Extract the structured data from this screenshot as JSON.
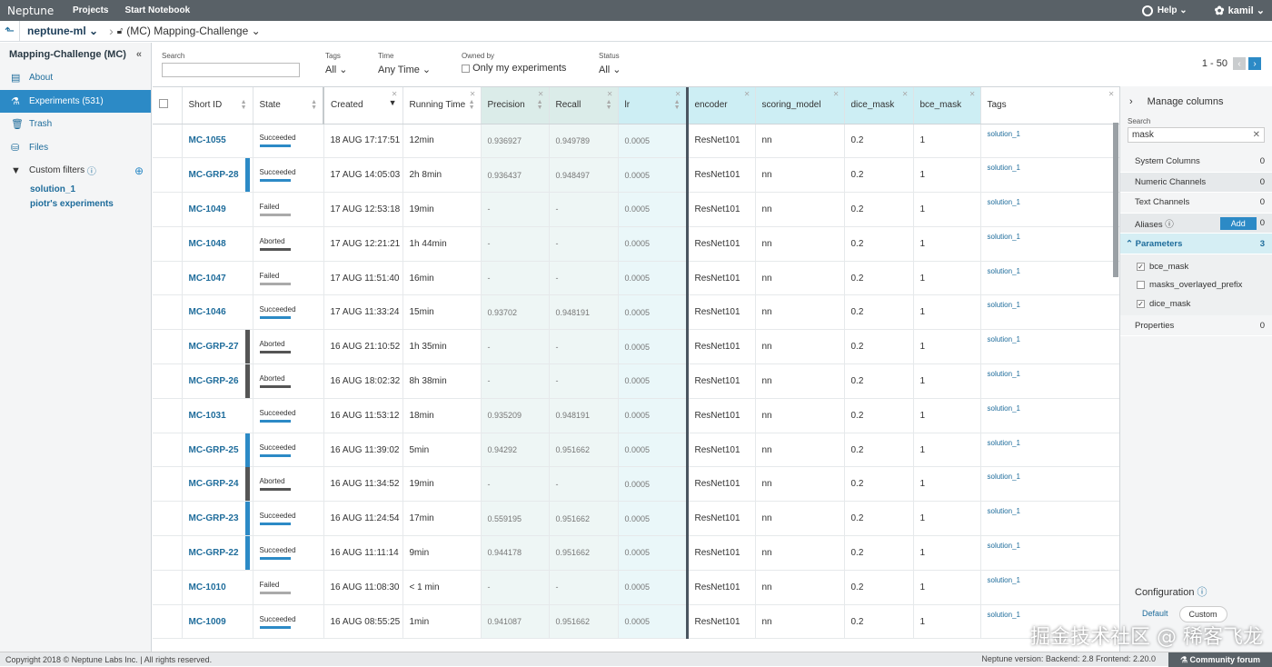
{
  "topbar": {
    "logo": "Neptune",
    "nav": [
      "Projects",
      "Start Notebook"
    ],
    "help": "Help",
    "user": "kamil"
  },
  "breadcrumb": {
    "org": "neptune-ml",
    "project": "(MC) Mapping-Challenge"
  },
  "sidebar": {
    "title": "Mapping-Challenge (MC)",
    "items": [
      {
        "label": "About"
      },
      {
        "label": "Experiments (531)"
      },
      {
        "label": "Trash"
      },
      {
        "label": "Files"
      }
    ],
    "filters_label": "Custom filters",
    "filters": [
      "solution_1",
      "piotr's experiments"
    ]
  },
  "filters": {
    "search_label": "Search",
    "tags_label": "Tags",
    "tags_value": "All",
    "time_label": "Time",
    "time_value": "Any Time",
    "owned_label": "Owned by",
    "owned_value": "Only my experiments",
    "status_label": "Status",
    "status_value": "All",
    "pager": "1 - 50"
  },
  "columns": [
    "Short ID",
    "State",
    "Created",
    "Running Time",
    "Precision",
    "Recall",
    "lr",
    "encoder",
    "scoring_model",
    "dice_mask",
    "bce_mask",
    "Tags"
  ],
  "rows": [
    {
      "id": "MC-1055",
      "state": "Succeeded",
      "created": "18 AUG 17:17:51",
      "running": "12min",
      "precision": "0.936927",
      "recall": "0.949789",
      "lr": "0.0005",
      "encoder": "ResNet101",
      "scoring": "nn",
      "dice": "0.2",
      "bce": "1",
      "tag": "solution_1",
      "group": false
    },
    {
      "id": "MC-GRP-28",
      "state": "Succeeded",
      "created": "17 AUG 14:05:03",
      "running": "2h 8min",
      "precision": "0.936437",
      "recall": "0.948497",
      "lr": "0.0005",
      "encoder": "ResNet101",
      "scoring": "nn",
      "dice": "0.2",
      "bce": "1",
      "tag": "solution_1",
      "group": true
    },
    {
      "id": "MC-1049",
      "state": "Failed",
      "created": "17 AUG 12:53:18",
      "running": "19min",
      "precision": "-",
      "recall": "-",
      "lr": "0.0005",
      "encoder": "ResNet101",
      "scoring": "nn",
      "dice": "0.2",
      "bce": "1",
      "tag": "solution_1",
      "group": false
    },
    {
      "id": "MC-1048",
      "state": "Aborted",
      "created": "17 AUG 12:21:21",
      "running": "1h 44min",
      "precision": "-",
      "recall": "-",
      "lr": "0.0005",
      "encoder": "ResNet101",
      "scoring": "nn",
      "dice": "0.2",
      "bce": "1",
      "tag": "solution_1",
      "group": false
    },
    {
      "id": "MC-1047",
      "state": "Failed",
      "created": "17 AUG 11:51:40",
      "running": "16min",
      "precision": "-",
      "recall": "-",
      "lr": "0.0005",
      "encoder": "ResNet101",
      "scoring": "nn",
      "dice": "0.2",
      "bce": "1",
      "tag": "solution_1",
      "group": false
    },
    {
      "id": "MC-1046",
      "state": "Succeeded",
      "created": "17 AUG 11:33:24",
      "running": "15min",
      "precision": "0.93702",
      "recall": "0.948191",
      "lr": "0.0005",
      "encoder": "ResNet101",
      "scoring": "nn",
      "dice": "0.2",
      "bce": "1",
      "tag": "solution_1",
      "group": false
    },
    {
      "id": "MC-GRP-27",
      "state": "Aborted",
      "created": "16 AUG 21:10:52",
      "running": "1h 35min",
      "precision": "-",
      "recall": "-",
      "lr": "0.0005",
      "encoder": "ResNet101",
      "scoring": "nn",
      "dice": "0.2",
      "bce": "1",
      "tag": "solution_1",
      "group": true
    },
    {
      "id": "MC-GRP-26",
      "state": "Aborted",
      "created": "16 AUG 18:02:32",
      "running": "8h 38min",
      "precision": "-",
      "recall": "-",
      "lr": "0.0005",
      "encoder": "ResNet101",
      "scoring": "nn",
      "dice": "0.2",
      "bce": "1",
      "tag": "solution_1",
      "group": true
    },
    {
      "id": "MC-1031",
      "state": "Succeeded",
      "created": "16 AUG 11:53:12",
      "running": "18min",
      "precision": "0.935209",
      "recall": "0.948191",
      "lr": "0.0005",
      "encoder": "ResNet101",
      "scoring": "nn",
      "dice": "0.2",
      "bce": "1",
      "tag": "solution_1",
      "group": false
    },
    {
      "id": "MC-GRP-25",
      "state": "Succeeded",
      "created": "16 AUG 11:39:02",
      "running": "5min",
      "precision": "0.94292",
      "recall": "0.951662",
      "lr": "0.0005",
      "encoder": "ResNet101",
      "scoring": "nn",
      "dice": "0.2",
      "bce": "1",
      "tag": "solution_1",
      "group": true
    },
    {
      "id": "MC-GRP-24",
      "state": "Aborted",
      "created": "16 AUG 11:34:52",
      "running": "19min",
      "precision": "-",
      "recall": "-",
      "lr": "0.0005",
      "encoder": "ResNet101",
      "scoring": "nn",
      "dice": "0.2",
      "bce": "1",
      "tag": "solution_1",
      "group": true
    },
    {
      "id": "MC-GRP-23",
      "state": "Succeeded",
      "created": "16 AUG 11:24:54",
      "running": "17min",
      "precision": "0.559195",
      "recall": "0.951662",
      "lr": "0.0005",
      "encoder": "ResNet101",
      "scoring": "nn",
      "dice": "0.2",
      "bce": "1",
      "tag": "solution_1",
      "group": true
    },
    {
      "id": "MC-GRP-22",
      "state": "Succeeded",
      "created": "16 AUG 11:11:14",
      "running": "9min",
      "precision": "0.944178",
      "recall": "0.951662",
      "lr": "0.0005",
      "encoder": "ResNet101",
      "scoring": "nn",
      "dice": "0.2",
      "bce": "1",
      "tag": "solution_1",
      "group": true
    },
    {
      "id": "MC-1010",
      "state": "Failed",
      "created": "16 AUG 11:08:30",
      "running": "< 1 min",
      "precision": "-",
      "recall": "-",
      "lr": "0.0005",
      "encoder": "ResNet101",
      "scoring": "nn",
      "dice": "0.2",
      "bce": "1",
      "tag": "solution_1",
      "group": false
    },
    {
      "id": "MC-1009",
      "state": "Succeeded",
      "created": "16 AUG 08:55:25",
      "running": "1min",
      "precision": "0.941087",
      "recall": "0.951662",
      "lr": "0.0005",
      "encoder": "ResNet101",
      "scoring": "nn",
      "dice": "0.2",
      "bce": "1",
      "tag": "solution_1",
      "group": false
    }
  ],
  "state_colors": {
    "Succeeded": "#2c8ac6",
    "Failed": "#aaaaaa",
    "Aborted": "#555555"
  },
  "manage": {
    "title": "Manage columns",
    "search_label": "Search",
    "search_value": "mask",
    "sections": [
      {
        "label": "System Columns",
        "count": "0"
      },
      {
        "label": "Numeric Channels",
        "count": "0"
      },
      {
        "label": "Text Channels",
        "count": "0"
      }
    ],
    "aliases": "Aliases",
    "aliases_count": "0",
    "add": "Add",
    "parameters": "Parameters",
    "parameters_count": "3",
    "params": [
      {
        "label": "bce_mask",
        "checked": true
      },
      {
        "label": "masks_overlayed_prefix",
        "checked": false
      },
      {
        "label": "dice_mask",
        "checked": true
      }
    ],
    "properties": "Properties",
    "properties_count": "0",
    "configuration": "Configuration",
    "default": "Default",
    "custom": "Custom"
  },
  "footer": {
    "copyright": "Copyright 2018 © Neptune Labs Inc. | All rights reserved.",
    "version": "Neptune version: Backend: 2.8 Frontend: 2.20.0",
    "forum": "Community forum"
  },
  "watermark": "掘金技术社区 @ 稀客飞龙"
}
